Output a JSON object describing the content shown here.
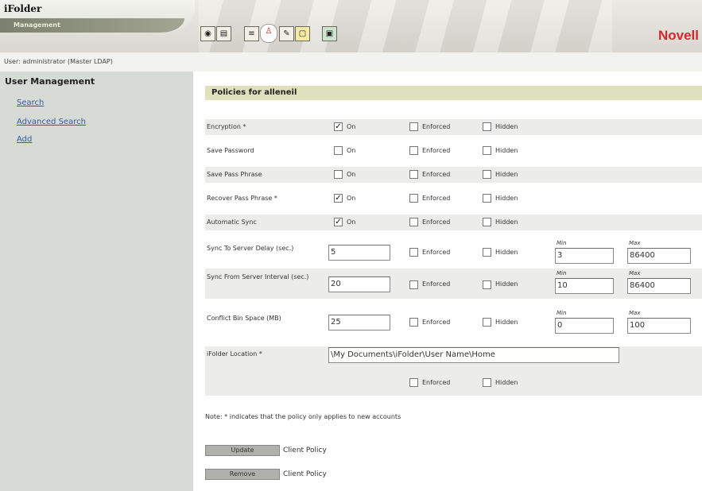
{
  "app": {
    "title": "iFolder",
    "subtitle": "Management",
    "brand": "Novell"
  },
  "user_line": "User: administrator (Master LDAP)",
  "toolbar": {
    "icons": [
      "users-icon",
      "server-icon",
      "document-icon",
      "user-policy-icon",
      "settings-icon",
      "report-icon",
      "system-icon"
    ],
    "active": "user-policy-icon"
  },
  "sidebar": {
    "heading": "User Management",
    "links": [
      "Search",
      "Advanced Search",
      "Add"
    ]
  },
  "policies": {
    "title": "Policies for alleneil",
    "on_label": "On",
    "enforced_label": "Enforced",
    "hidden_label": "Hidden",
    "min_label": "Min",
    "max_label": "Max",
    "rows": [
      {
        "label": "Encryption *",
        "on": true,
        "enforced": false,
        "hidden": false
      },
      {
        "label": "Save Password",
        "on": false,
        "enforced": false,
        "hidden": false
      },
      {
        "label": "Save Pass Phrase",
        "on": false,
        "enforced": false,
        "hidden": false
      },
      {
        "label": "Recover Pass Phrase *",
        "on": true,
        "enforced": false,
        "hidden": false
      },
      {
        "label": "Automatic Sync",
        "on": true,
        "enforced": false,
        "hidden": false
      }
    ],
    "numeric_rows": [
      {
        "label": "Sync To Server Delay (sec.)",
        "value": "5",
        "enforced": false,
        "hidden": false,
        "min": "3",
        "max": "86400"
      },
      {
        "label": "Sync From Server Interval (sec.)",
        "value": "20",
        "enforced": false,
        "hidden": false,
        "min": "10",
        "max": "86400"
      },
      {
        "label": "Conflict Bin Space (MB)",
        "value": "25",
        "enforced": false,
        "hidden": false,
        "min": "0",
        "max": "100"
      }
    ],
    "location": {
      "label": "iFolder Location *",
      "value": "\\My Documents\\iFolder\\User Name\\Home",
      "enforced": false,
      "hidden": false
    }
  },
  "note": "Note: * indicates that the policy only applies to new accounts",
  "actions": [
    {
      "button": "Update",
      "text": "Client Policy"
    },
    {
      "button": "Remove",
      "text": "Client Policy"
    }
  ]
}
